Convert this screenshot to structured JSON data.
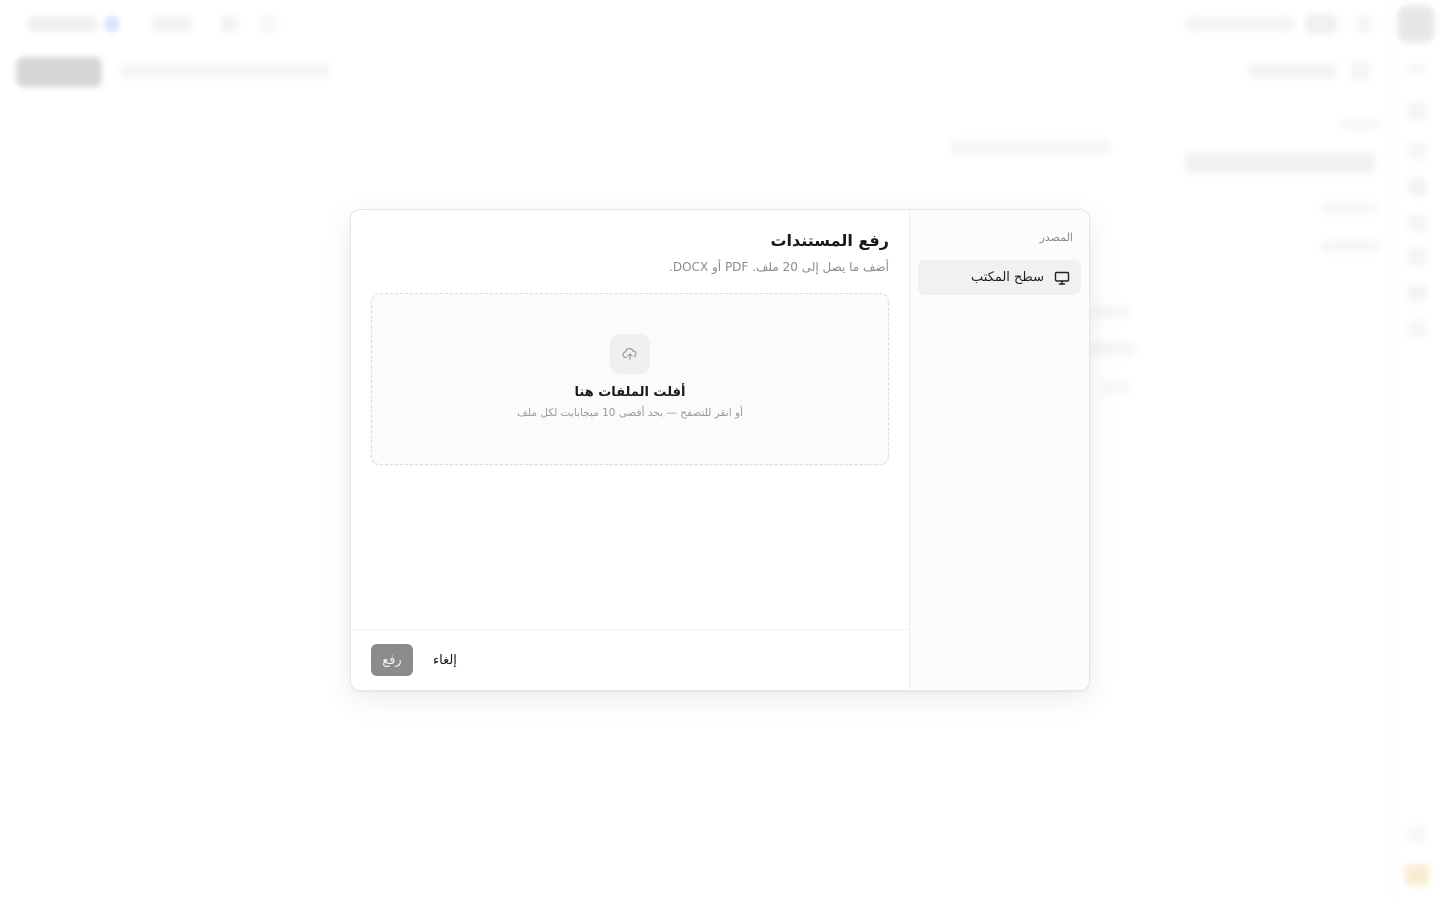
{
  "modal": {
    "title": "رفع المستندات",
    "subtitle": "أضف ما يصل إلى 20 ملف. PDF أو DOCX.",
    "sidebar": {
      "heading": "المصدر",
      "sources": [
        {
          "label": "سطح المكتب",
          "icon": "monitor-icon",
          "selected": true
        }
      ]
    },
    "dropzone": {
      "icon": "cloud-upload-icon",
      "title": "أفلت الملفات هنا",
      "hint": "أو انقر للتصفح — بحد أقصى 10 ميجابايت لكل ملف"
    },
    "footer": {
      "upload_label": "رفع",
      "cancel_label": "إلغاء",
      "upload_disabled": true
    }
  },
  "colors": {
    "primary_disabled": "#8c8c8c",
    "selected_source_bg": "#f1f1f1",
    "muted_text": "#8a8a8a"
  }
}
